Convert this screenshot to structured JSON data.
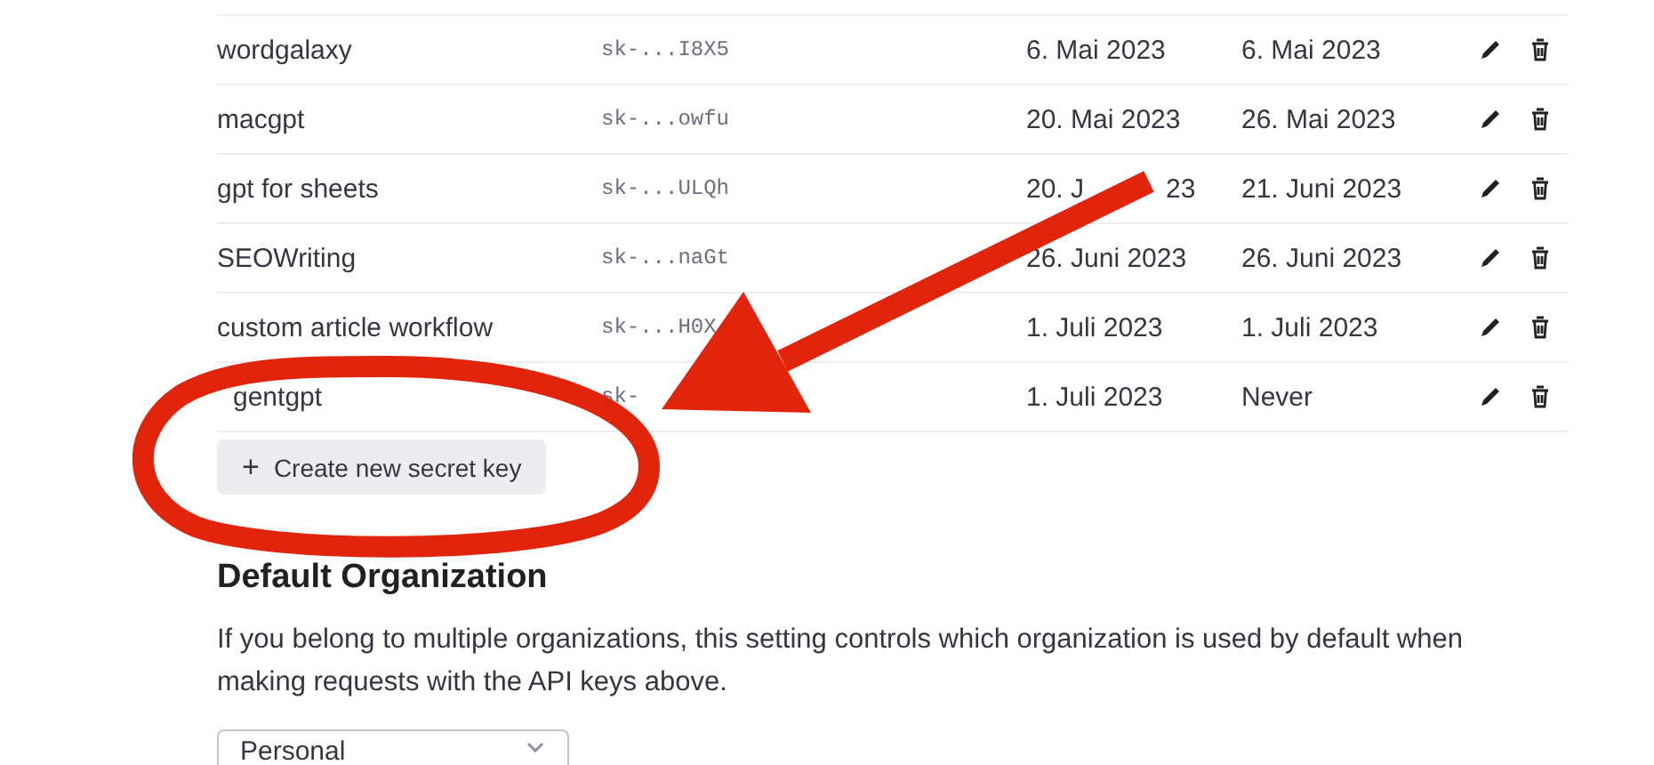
{
  "api_keys": {
    "rows": [
      {
        "name": "wordgalaxy",
        "key": "sk-...I8X5",
        "created": [
          "6. Mai 2023"
        ],
        "last_used": "6. Mai 2023"
      },
      {
        "name": "macgpt",
        "key": "sk-...owfu",
        "created": [
          "20. Mai 2023"
        ],
        "last_used": "26. Mai 2023"
      },
      {
        "name": "gpt for sheets",
        "key": "sk-...ULQh",
        "created": [
          "20. J",
          "23"
        ],
        "last_used": "21. Juni 2023"
      },
      {
        "name": "SEOWriting",
        "key": "sk-...naGt",
        "created": [
          "26. Juni 2023"
        ],
        "last_used": "26. Juni 2023"
      },
      {
        "name": "custom article workflow",
        "key": "sk-...H0X",
        "created": [
          "1. Juli 2023"
        ],
        "last_used": "1. Juli 2023"
      },
      {
        "name": "gentgpt",
        "key": "sk-",
        "created": [
          "1. Juli 2023"
        ],
        "last_used": "Never"
      }
    ],
    "create_button": {
      "icon": "+",
      "label": "Create new secret key"
    }
  },
  "default_organization": {
    "heading": "Default Organization",
    "description": "If you belong to multiple organizations, this setting controls which organization is used by default when making requests with the API keys above.",
    "select": {
      "value": "Personal"
    }
  }
}
